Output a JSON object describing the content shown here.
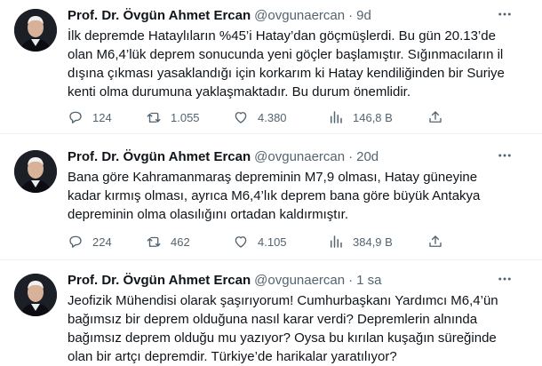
{
  "tweets": [
    {
      "name": "Prof. Dr. Övgün Ahmet Ercan",
      "handle": "@ovgunaercan",
      "separator": "·",
      "time": "9d",
      "lines": [
        "İlk depremde Hataylıların %45’i Hatay’dan göçmüşlerdi. Bu gün 20.13’de",
        "olan M6,4’lük deprem sonucunda yeni göçler başlamıştır. Sığınmacıların il",
        "dışına çıkması yasaklandığı için korkarım ki Hatay kendiliğinden bir Suriye",
        "kenti olma durumuna yaklaşmaktadır. Bu durum önemlidir."
      ],
      "replies": "124",
      "retweets": "1.055",
      "likes": "4.380",
      "views": "146,8 B"
    },
    {
      "name": "Prof. Dr. Övgün Ahmet Ercan",
      "handle": "@ovgunaercan",
      "separator": "·",
      "time": "20d",
      "lines": [
        "Bana göre Kahramanmaraş depreminin M7,9 olması, Hatay güneyine",
        "kadar kırmış olması, ayrıca M6,4’lık deprem bana göre büyük Antakya",
        "depreminin olma olasılığını ortadan kaldırmıştır."
      ],
      "replies": "224",
      "retweets": "462",
      "likes": "4.105",
      "views": "384,9 B"
    },
    {
      "name": "Prof. Dr. Övgün Ahmet Ercan",
      "handle": "@ovgunaercan",
      "separator": "·",
      "time": "1 sa",
      "lines": [
        "Jeofizik Mühendisi olarak şaşırıyorum! Cumhurbaşkanı Yardımcı M6,4’ün",
        "bağımsız bir deprem olduğuna nasıl karar verdi? Depremlerin alnında",
        "bağımsız deprem olduğu mu yazıyor? Oysa bu kırılan kuşağın süreğinde",
        "olan bir artçı depremdir. Türkiye’de harikalar yaratılıyor?"
      ]
    }
  ],
  "icons": {
    "more": "more-dots-icon",
    "reply": "reply-bubble-icon",
    "retweet": "retweet-arrows-icon",
    "like": "heart-icon",
    "views": "bar-chart-icon",
    "share": "share-upload-icon"
  },
  "colors": {
    "text": "#0f1419",
    "secondary": "#536471",
    "divider": "#eff3f4"
  }
}
